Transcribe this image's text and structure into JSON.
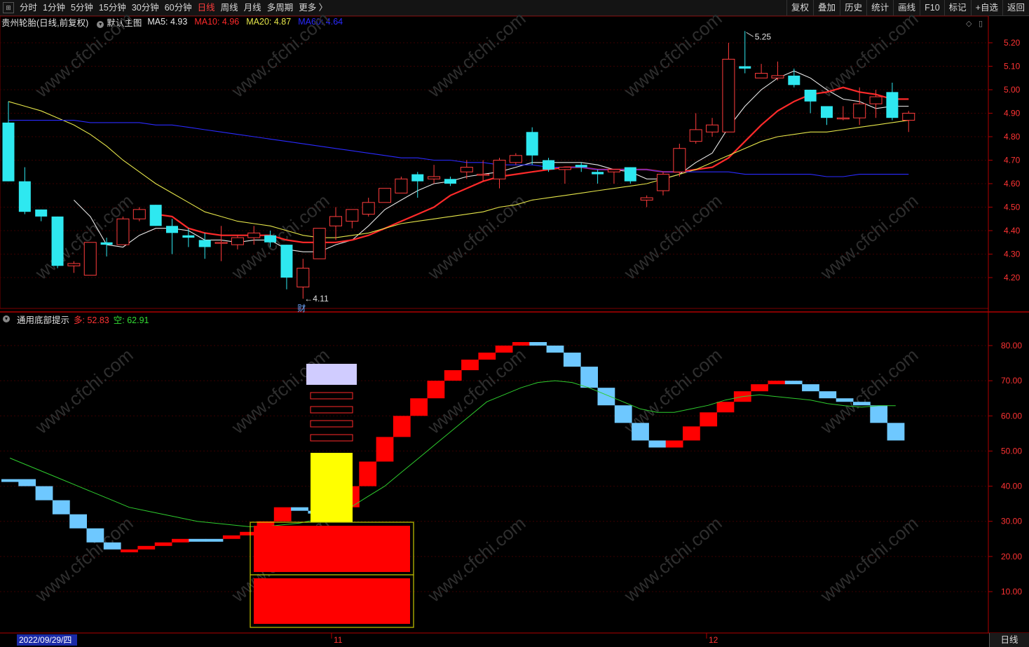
{
  "toolbar": {
    "periods": [
      "分时",
      "1分钟",
      "5分钟",
      "15分钟",
      "30分钟",
      "60分钟",
      "日线",
      "周线",
      "月线",
      "多周期",
      "更多 〉"
    ],
    "active_period": "日线",
    "right_buttons": [
      "复权",
      "叠加",
      "历史",
      "统计",
      "画线",
      "F10",
      "标记",
      "+自选",
      "返回"
    ]
  },
  "main_chart": {
    "stock_label": "贵州轮胎(日线,前复权)",
    "template_label": "默认主图",
    "ma": [
      {
        "label": "MA5: 4.93",
        "value": 4.93,
        "color": "#e8e8e8"
      },
      {
        "label": "MA10: 4.96",
        "value": 4.96,
        "color": "#ff2a2a"
      },
      {
        "label": "MA20: 4.87",
        "value": 4.87,
        "color": "#e6e64a"
      },
      {
        "label": "MA60: 4.64",
        "value": 4.64,
        "color": "#2a2aff"
      }
    ],
    "high_label": "5.25",
    "low_label": "4.11",
    "event_label": "财",
    "y_ticks": [
      "5.20",
      "5.10",
      "5.00",
      "4.90",
      "4.80",
      "4.70",
      "4.60",
      "4.50",
      "4.40",
      "4.30",
      "4.20"
    ]
  },
  "indicator": {
    "name": "通用底部提示",
    "bull_label": "多: 52.83",
    "bear_label": "空: 62.91",
    "y_ticks": [
      "80.00",
      "70.00",
      "60.00",
      "50.00",
      "40.00",
      "30.00",
      "20.00",
      "10.00"
    ]
  },
  "x_axis": {
    "cursor_date": "2022/09/29/四",
    "month_labels": [
      "11",
      "12"
    ],
    "period_label": "日线"
  },
  "watermark": "www.cfchi.com",
  "chart_data": {
    "type": "candlestick",
    "price_ylim": [
      4.1,
      5.28
    ],
    "candles": [
      {
        "o": 4.86,
        "h": 4.95,
        "c": 4.61,
        "l": 4.61
      },
      {
        "o": 4.61,
        "h": 4.67,
        "c": 4.48,
        "l": 4.47
      },
      {
        "o": 4.49,
        "h": 4.49,
        "c": 4.46,
        "l": 4.44
      },
      {
        "o": 4.46,
        "h": 4.46,
        "c": 4.25,
        "l": 4.24
      },
      {
        "o": 4.25,
        "h": 4.27,
        "c": 4.26,
        "l": 4.22
      },
      {
        "o": 4.21,
        "h": 4.35,
        "c": 4.35,
        "l": 4.21
      },
      {
        "o": 4.35,
        "h": 4.37,
        "c": 4.34,
        "l": 4.29
      },
      {
        "o": 4.34,
        "h": 4.46,
        "c": 4.45,
        "l": 4.34
      },
      {
        "o": 4.45,
        "h": 4.5,
        "c": 4.49,
        "l": 4.44
      },
      {
        "o": 4.51,
        "h": 4.51,
        "c": 4.42,
        "l": 4.42
      },
      {
        "o": 4.42,
        "h": 4.45,
        "c": 4.39,
        "l": 4.3
      },
      {
        "o": 4.38,
        "h": 4.41,
        "c": 4.37,
        "l": 4.33
      },
      {
        "o": 4.36,
        "h": 4.39,
        "c": 4.33,
        "l": 4.28
      },
      {
        "o": 4.35,
        "h": 4.42,
        "c": 4.35,
        "l": 4.27
      },
      {
        "o": 4.34,
        "h": 4.38,
        "c": 4.37,
        "l": 4.32
      },
      {
        "o": 4.37,
        "h": 4.42,
        "c": 4.39,
        "l": 4.34
      },
      {
        "o": 4.38,
        "h": 4.4,
        "c": 4.35,
        "l": 4.33
      },
      {
        "o": 4.34,
        "h": 4.34,
        "c": 4.2,
        "l": 4.15
      },
      {
        "o": 4.16,
        "h": 4.28,
        "c": 4.24,
        "l": 4.11
      },
      {
        "o": 4.28,
        "h": 4.41,
        "c": 4.41,
        "l": 4.28
      },
      {
        "o": 4.42,
        "h": 4.5,
        "c": 4.46,
        "l": 4.36
      },
      {
        "o": 4.44,
        "h": 4.49,
        "c": 4.49,
        "l": 4.41
      },
      {
        "o": 4.47,
        "h": 4.54,
        "c": 4.52,
        "l": 4.46
      },
      {
        "o": 4.52,
        "h": 4.58,
        "c": 4.58,
        "l": 4.52
      },
      {
        "o": 4.56,
        "h": 4.63,
        "c": 4.62,
        "l": 4.56
      },
      {
        "o": 4.64,
        "h": 4.65,
        "c": 4.61,
        "l": 4.54
      },
      {
        "o": 4.62,
        "h": 4.68,
        "c": 4.63,
        "l": 4.6
      },
      {
        "o": 4.62,
        "h": 4.63,
        "c": 4.6,
        "l": 4.59
      },
      {
        "o": 4.65,
        "h": 4.7,
        "c": 4.67,
        "l": 4.62
      },
      {
        "o": 4.64,
        "h": 4.7,
        "c": 4.64,
        "l": 4.61
      },
      {
        "o": 4.62,
        "h": 4.71,
        "c": 4.7,
        "l": 4.58
      },
      {
        "o": 4.69,
        "h": 4.73,
        "c": 4.72,
        "l": 4.68
      },
      {
        "o": 4.82,
        "h": 4.84,
        "c": 4.72,
        "l": 4.68
      },
      {
        "o": 4.7,
        "h": 4.71,
        "c": 4.66,
        "l": 4.65
      },
      {
        "o": 4.66,
        "h": 4.67,
        "c": 4.67,
        "l": 4.6
      },
      {
        "o": 4.68,
        "h": 4.69,
        "c": 4.67,
        "l": 4.65
      },
      {
        "o": 4.65,
        "h": 4.66,
        "c": 4.64,
        "l": 4.6
      },
      {
        "o": 4.65,
        "h": 4.66,
        "c": 4.66,
        "l": 4.6
      },
      {
        "o": 4.67,
        "h": 4.67,
        "c": 4.61,
        "l": 4.6
      },
      {
        "o": 4.53,
        "h": 4.55,
        "c": 4.54,
        "l": 4.5
      },
      {
        "o": 4.57,
        "h": 4.65,
        "c": 4.64,
        "l": 4.55
      },
      {
        "o": 4.65,
        "h": 4.77,
        "c": 4.75,
        "l": 4.63
      },
      {
        "o": 4.78,
        "h": 4.9,
        "c": 4.83,
        "l": 4.77
      },
      {
        "o": 4.82,
        "h": 4.88,
        "c": 4.85,
        "l": 4.8
      },
      {
        "o": 4.82,
        "h": 5.2,
        "c": 5.13,
        "l": 4.82
      },
      {
        "o": 5.1,
        "h": 5.25,
        "c": 5.09,
        "l": 5.07
      },
      {
        "o": 5.05,
        "h": 5.11,
        "c": 5.07,
        "l": 5.05
      },
      {
        "o": 5.05,
        "h": 5.12,
        "c": 5.06,
        "l": 5.04
      },
      {
        "o": 5.06,
        "h": 5.09,
        "c": 5.02,
        "l": 5.01
      },
      {
        "o": 5.0,
        "h": 5.0,
        "c": 4.95,
        "l": 4.9
      },
      {
        "o": 4.93,
        "h": 4.93,
        "c": 4.88,
        "l": 4.85
      },
      {
        "o": 4.88,
        "h": 4.93,
        "c": 4.88,
        "l": 4.87
      },
      {
        "o": 4.88,
        "h": 5.01,
        "c": 4.94,
        "l": 4.85
      },
      {
        "o": 4.94,
        "h": 5.0,
        "c": 4.97,
        "l": 4.88
      },
      {
        "o": 4.99,
        "h": 5.03,
        "c": 4.88,
        "l": 4.87
      },
      {
        "o": 4.87,
        "h": 4.91,
        "c": 4.9,
        "l": 4.82
      }
    ],
    "ma_series": [
      {
        "name": "MA5",
        "color": "#e8e8e8",
        "values": [
          null,
          null,
          null,
          null,
          4.53,
          4.46,
          4.34,
          4.33,
          4.38,
          4.41,
          4.41,
          4.4,
          4.36,
          4.36,
          4.35,
          4.36,
          4.36,
          4.32,
          4.31,
          4.31,
          4.34,
          4.36,
          4.42,
          4.49,
          4.53,
          4.57,
          4.6,
          4.61,
          4.63,
          4.64,
          4.65,
          4.67,
          4.69,
          4.69,
          4.69,
          4.69,
          4.68,
          4.66,
          4.65,
          4.62,
          4.62,
          4.64,
          4.69,
          4.73,
          4.84,
          4.93,
          5.0,
          5.05,
          5.08,
          5.05,
          5.0,
          4.96,
          4.95,
          4.92,
          4.93,
          4.93
        ]
      },
      {
        "name": "MA10",
        "color": "#ff2a2a",
        "values": [
          null,
          null,
          null,
          null,
          null,
          null,
          null,
          null,
          null,
          4.47,
          4.46,
          4.41,
          4.39,
          4.38,
          4.38,
          4.38,
          4.38,
          4.36,
          4.35,
          4.35,
          4.35,
          4.36,
          4.38,
          4.41,
          4.44,
          4.47,
          4.5,
          4.55,
          4.58,
          4.61,
          4.63,
          4.64,
          4.65,
          4.66,
          4.67,
          4.67,
          4.66,
          4.66,
          4.66,
          4.66,
          4.65,
          4.65,
          4.66,
          4.67,
          4.71,
          4.78,
          4.85,
          4.91,
          4.95,
          4.98,
          4.99,
          5.01,
          4.99,
          4.98,
          4.96,
          4.96
        ]
      },
      {
        "name": "MA20",
        "color": "#e6e64a",
        "values": [
          4.95,
          4.93,
          4.91,
          4.88,
          4.85,
          4.81,
          4.76,
          4.7,
          4.65,
          4.6,
          4.56,
          4.52,
          4.48,
          4.46,
          4.44,
          4.43,
          4.42,
          4.4,
          4.38,
          4.37,
          4.37,
          4.38,
          4.39,
          4.41,
          4.43,
          4.44,
          4.45,
          4.46,
          4.47,
          4.48,
          4.5,
          4.51,
          4.53,
          4.54,
          4.55,
          4.56,
          4.57,
          4.58,
          4.59,
          4.6,
          4.62,
          4.64,
          4.66,
          4.69,
          4.72,
          4.75,
          4.78,
          4.8,
          4.81,
          4.82,
          4.82,
          4.83,
          4.84,
          4.85,
          4.86,
          4.87
        ]
      },
      {
        "name": "MA60",
        "color": "#2a2aff",
        "values": [
          4.87,
          4.87,
          4.87,
          4.87,
          4.87,
          4.86,
          4.86,
          4.86,
          4.86,
          4.85,
          4.85,
          4.84,
          4.83,
          4.82,
          4.81,
          4.8,
          4.79,
          4.78,
          4.77,
          4.76,
          4.75,
          4.74,
          4.73,
          4.72,
          4.71,
          4.71,
          4.7,
          4.7,
          4.69,
          4.69,
          4.68,
          4.68,
          4.68,
          4.67,
          4.67,
          4.67,
          4.66,
          4.66,
          4.66,
          4.66,
          4.65,
          4.65,
          4.65,
          4.65,
          4.65,
          4.64,
          4.64,
          4.64,
          4.64,
          4.64,
          4.63,
          4.63,
          4.64,
          4.64,
          4.64,
          4.64
        ]
      }
    ],
    "indicator_ylim": [
      0,
      90
    ],
    "indicator_steps": [
      {
        "i": 0,
        "v": 42,
        "up": false
      },
      {
        "i": 1,
        "v": 40,
        "up": false
      },
      {
        "i": 2,
        "v": 36,
        "up": false
      },
      {
        "i": 3,
        "v": 32,
        "up": false
      },
      {
        "i": 4,
        "v": 28,
        "up": false
      },
      {
        "i": 5,
        "v": 24,
        "up": false
      },
      {
        "i": 6,
        "v": 22,
        "up": false
      },
      {
        "i": 7,
        "v": 22,
        "up": true
      },
      {
        "i": 8,
        "v": 23,
        "up": true
      },
      {
        "i": 9,
        "v": 24,
        "up": true
      },
      {
        "i": 10,
        "v": 25,
        "up": true
      },
      {
        "i": 11,
        "v": 25,
        "up": false
      },
      {
        "i": 12,
        "v": 25,
        "up": false
      },
      {
        "i": 13,
        "v": 26,
        "up": true
      },
      {
        "i": 14,
        "v": 27,
        "up": true
      },
      {
        "i": 15,
        "v": 30,
        "up": true
      },
      {
        "i": 16,
        "v": 34,
        "up": true
      },
      {
        "i": 17,
        "v": 33,
        "up": false
      },
      {
        "i": 18,
        "v": 33,
        "up": false
      },
      {
        "i": 19,
        "v": 34,
        "up": true
      },
      {
        "i": 20,
        "v": 40,
        "up": true
      },
      {
        "i": 21,
        "v": 47,
        "up": true
      },
      {
        "i": 22,
        "v": 54,
        "up": true
      },
      {
        "i": 23,
        "v": 60,
        "up": true
      },
      {
        "i": 24,
        "v": 65,
        "up": true
      },
      {
        "i": 25,
        "v": 70,
        "up": true
      },
      {
        "i": 26,
        "v": 73,
        "up": true
      },
      {
        "i": 27,
        "v": 76,
        "up": true
      },
      {
        "i": 28,
        "v": 78,
        "up": true
      },
      {
        "i": 29,
        "v": 80,
        "up": true
      },
      {
        "i": 30,
        "v": 81,
        "up": true
      },
      {
        "i": 31,
        "v": 80,
        "up": false
      },
      {
        "i": 32,
        "v": 78,
        "up": false
      },
      {
        "i": 33,
        "v": 74,
        "up": false
      },
      {
        "i": 34,
        "v": 68,
        "up": false
      },
      {
        "i": 35,
        "v": 63,
        "up": false
      },
      {
        "i": 36,
        "v": 58,
        "up": false
      },
      {
        "i": 37,
        "v": 53,
        "up": false
      },
      {
        "i": 38,
        "v": 51,
        "up": false
      },
      {
        "i": 39,
        "v": 53,
        "up": true
      },
      {
        "i": 40,
        "v": 57,
        "up": true
      },
      {
        "i": 41,
        "v": 61,
        "up": true
      },
      {
        "i": 42,
        "v": 64,
        "up": true
      },
      {
        "i": 43,
        "v": 67,
        "up": true
      },
      {
        "i": 44,
        "v": 69,
        "up": true
      },
      {
        "i": 45,
        "v": 70,
        "up": true
      },
      {
        "i": 46,
        "v": 69,
        "up": false
      },
      {
        "i": 47,
        "v": 67,
        "up": false
      },
      {
        "i": 48,
        "v": 65,
        "up": false
      },
      {
        "i": 49,
        "v": 64,
        "up": false
      },
      {
        "i": 50,
        "v": 63,
        "up": false
      },
      {
        "i": 51,
        "v": 58,
        "up": false
      },
      {
        "i": 52,
        "v": 53,
        "up": false
      }
    ],
    "indicator_line": [
      48,
      46,
      44,
      42,
      40,
      38,
      36,
      34,
      33,
      32,
      31,
      30,
      29.5,
      29,
      28.5,
      28.5,
      29,
      29.5,
      30.5,
      32,
      34,
      37,
      40,
      44,
      48,
      52,
      56,
      60,
      64,
      66,
      68,
      69.5,
      70,
      69.5,
      68,
      66,
      64,
      62,
      61,
      61,
      62,
      63,
      64.5,
      65.5,
      66,
      65.5,
      65,
      64.5,
      63.5,
      62.9,
      62.5,
      62.9,
      62.9
    ]
  }
}
